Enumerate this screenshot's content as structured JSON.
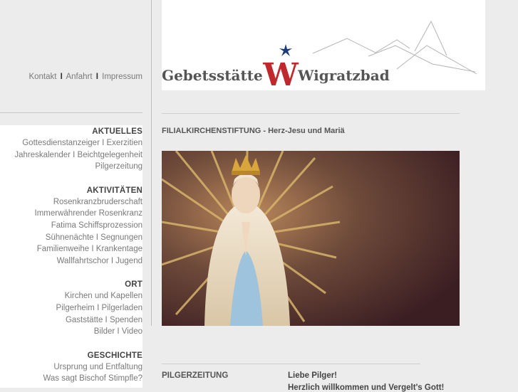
{
  "top_links": [
    "Kontakt",
    "Anfahrt",
    "Impressum"
  ],
  "sidebar": {
    "groups": [
      {
        "heading": "AKTUELLES",
        "items": [
          "Gottesdienstanzeiger I Exerzitien",
          "Jahreskalender I Beichtgelegenheit",
          "Pilgerzeitung"
        ]
      },
      {
        "heading": "AKTIVITÄTEN",
        "items": [
          "Rosenkranzbruderschaft",
          "Immerwährender Rosenkranz",
          "Fatima Schiffsprozession",
          "Sühnenächte I Segnungen",
          "Familienweihe I Krankentage",
          "Wallfahrtschor I Jugend"
        ]
      },
      {
        "heading": "ORT",
        "items": [
          "Kirchen und Kapellen",
          "Pilgerheim I Pilgerladen",
          "Gaststätte I Spenden",
          "Bilder I Video"
        ]
      },
      {
        "heading": "GESCHICHTE",
        "items": [
          "Ursprung und Entfaltung",
          "Was sagt Bischof Stimpfle?"
        ]
      }
    ]
  },
  "banner": {
    "name_left": "Gebetsstätte",
    "name_right": "Wigratzbad",
    "logo_letter": "W"
  },
  "colors": {
    "accent": "#c0282d",
    "star": "#1f3a7a"
  },
  "page_heading": "FILIALKIRCHENSTIFTUNG - Herz-Jesu und Mariä",
  "pilgerzeitung": {
    "label": "PILGERZEITUNG",
    "greeting": "Liebe Pilger!",
    "greeting_line2": "Herzlich willkommen und Vergelt's Gott!"
  }
}
